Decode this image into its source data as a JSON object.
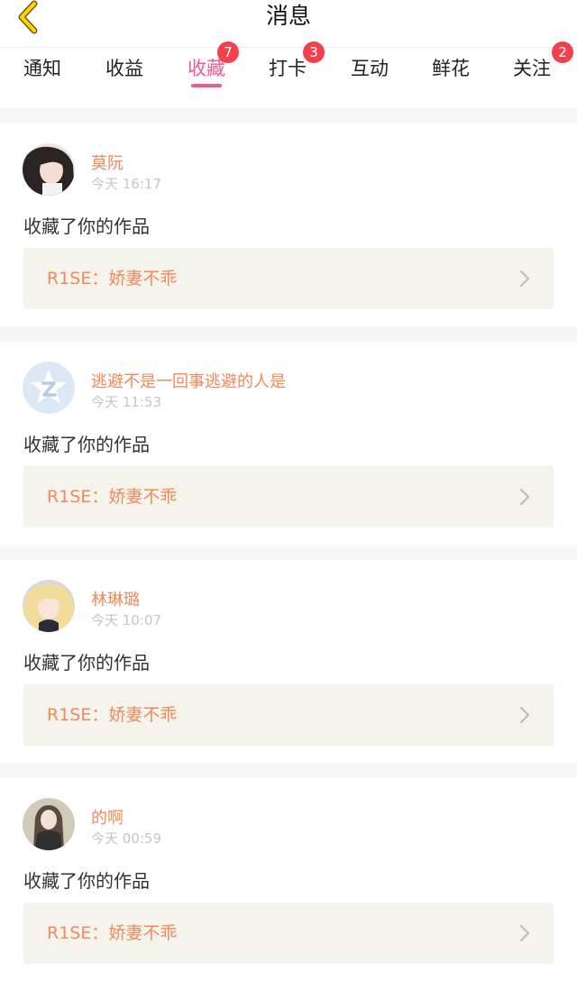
{
  "header": {
    "title": "消息"
  },
  "tabs": [
    {
      "label": "通知",
      "badge": ""
    },
    {
      "label": "收益",
      "badge": ""
    },
    {
      "label": "收藏",
      "badge": "7"
    },
    {
      "label": "打卡",
      "badge": "3"
    },
    {
      "label": "互动",
      "badge": ""
    },
    {
      "label": "鲜花",
      "badge": ""
    },
    {
      "label": "关注",
      "badge": "2"
    }
  ],
  "active_tab": "收藏",
  "feed": [
    {
      "username": "莫阮",
      "time": "今天 16:17",
      "action": "收藏了你的作品",
      "work_title": "R1SE：娇妻不乖"
    },
    {
      "username": "逃避不是一回事逃避的人是",
      "time": "今天 11:53",
      "action": "收藏了你的作品",
      "work_title": "R1SE：娇妻不乖"
    },
    {
      "username": "林琳璐",
      "time": "今天 10:07",
      "action": "收藏了你的作品",
      "work_title": "R1SE：娇妻不乖"
    },
    {
      "username": "的啊",
      "time": "今天 00:59",
      "action": "收藏了你的作品",
      "work_title": "R1SE：娇妻不乖"
    }
  ],
  "colors": {
    "accent_pink": "#f05a93",
    "name_orange": "#f08a5a",
    "badge_red": "#f4404d",
    "card_bg": "#f4f4ec",
    "separator": "#f7f7f7"
  }
}
